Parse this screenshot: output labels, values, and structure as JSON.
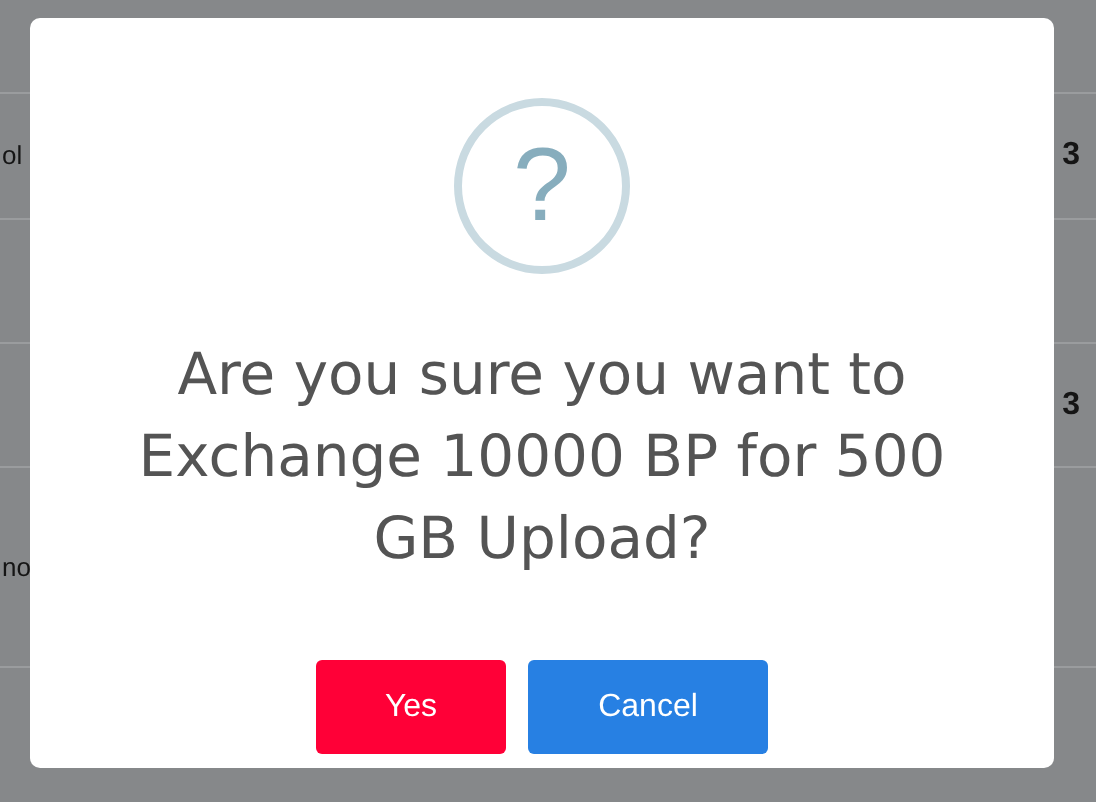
{
  "background_table": {
    "rows": [
      {
        "cells": [
          "",
          "",
          ""
        ]
      },
      {
        "cells": [
          "ol",
          "",
          "3"
        ]
      },
      {
        "cells": [
          "",
          "",
          ""
        ]
      },
      {
        "cells": [
          "",
          "",
          "3"
        ]
      },
      {
        "cells": [
          "no",
          "",
          ""
        ]
      }
    ]
  },
  "dialog": {
    "icon": "?",
    "message": "Are you sure you want to Exchange 10000 BP for 500 GB Upload?",
    "buttons": [
      {
        "label": "Yes",
        "kind": "confirm"
      },
      {
        "label": "Cancel",
        "kind": "cancel"
      }
    ]
  }
}
